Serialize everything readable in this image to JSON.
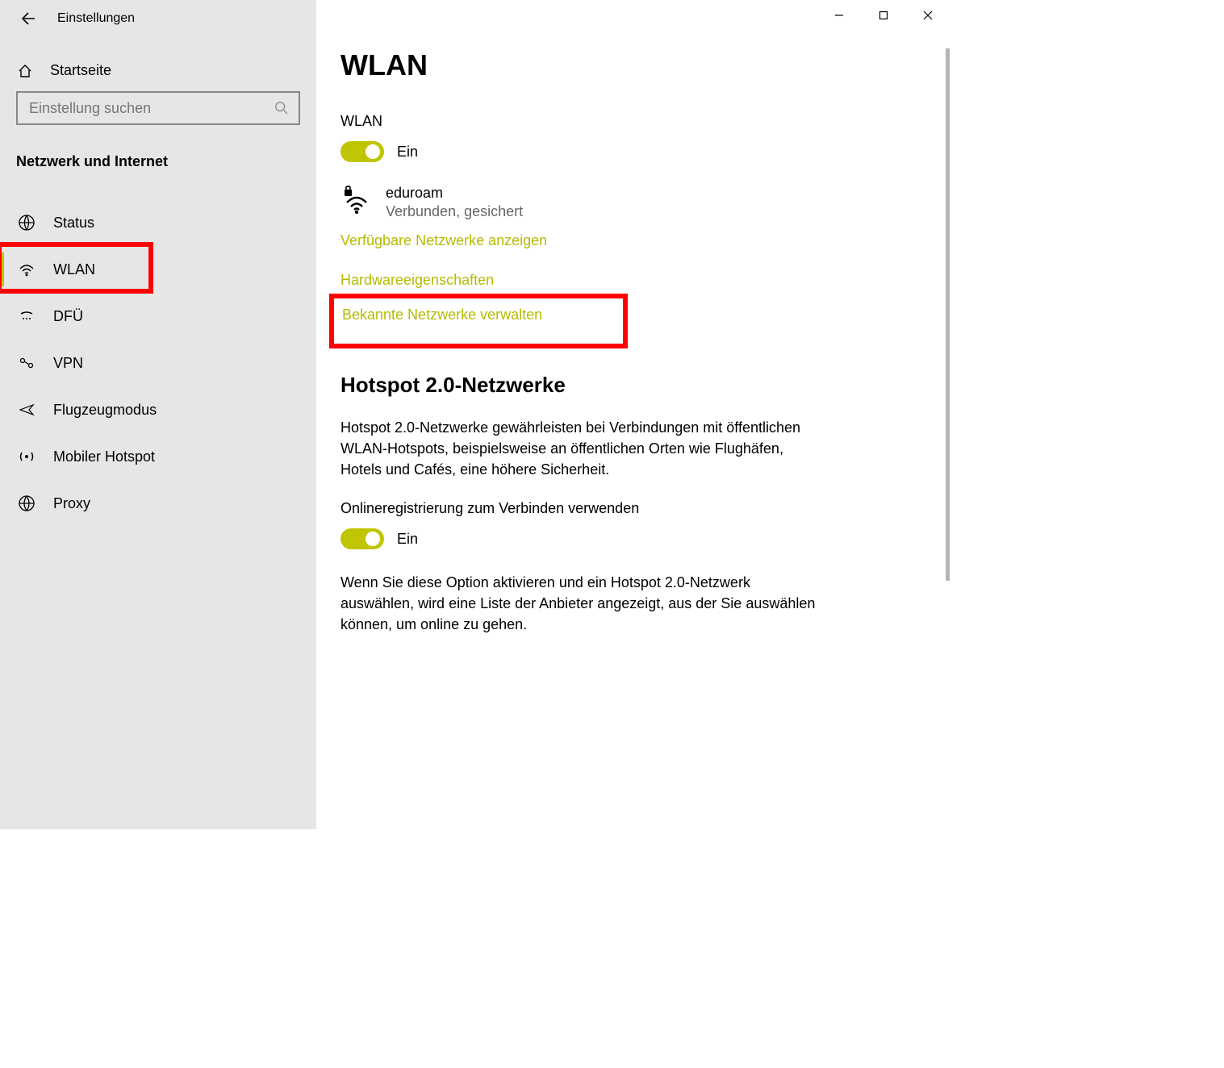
{
  "app_title": "Einstellungen",
  "home_label": "Startseite",
  "search_placeholder": "Einstellung suchen",
  "category_title": "Netzwerk und Internet",
  "nav_items": [
    {
      "label": "Status"
    },
    {
      "label": "WLAN"
    },
    {
      "label": "DFÜ"
    },
    {
      "label": "VPN"
    },
    {
      "label": "Flugzeugmodus"
    },
    {
      "label": "Mobiler Hotspot"
    },
    {
      "label": "Proxy"
    }
  ],
  "page_title": "WLAN",
  "wlan_label": "WLAN",
  "wlan_toggle_state": "Ein",
  "network_name": "eduroam",
  "network_status": "Verbunden, gesichert",
  "link_available": "Verfügbare Netzwerke anzeigen",
  "link_hardware": "Hardwareeigenschaften",
  "link_known": "Bekannte Netzwerke verwalten",
  "hotspot_title": "Hotspot 2.0-Netzwerke",
  "hotspot_desc": "Hotspot 2.0-Netzwerke gewährleisten bei Verbindungen mit öffentlichen WLAN-Hotspots, beispielsweise an öffentlichen Orten wie Flughäfen, Hotels und Cafés, eine höhere Sicherheit.",
  "online_reg_label": "Onlineregistrierung zum Verbinden verwenden",
  "online_reg_state": "Ein",
  "online_reg_desc": "Wenn Sie diese Option aktivieren und ein Hotspot 2.0-Netzwerk auswählen, wird eine Liste der Anbieter angezeigt, aus der Sie auswählen können, um online zu gehen."
}
